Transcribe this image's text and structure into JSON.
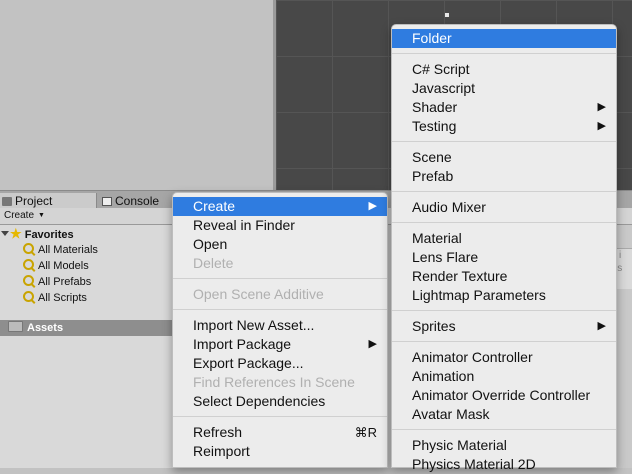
{
  "tabs": {
    "project": "Project",
    "console": "Console"
  },
  "toolbar": {
    "create": "Create"
  },
  "tree": {
    "favorites": "Favorites",
    "items": [
      "All Materials",
      "All Models",
      "All Prefabs",
      "All Scripts"
    ],
    "assets": "Assets"
  },
  "right_hint": "i\nis",
  "context_menu": {
    "create": "Create",
    "reveal": "Reveal in Finder",
    "open": "Open",
    "delete": "Delete",
    "open_scene_additive": "Open Scene Additive",
    "import_new_asset": "Import New Asset...",
    "import_package": "Import Package",
    "export_package": "Export Package...",
    "find_references": "Find References In Scene",
    "select_dependencies": "Select Dependencies",
    "refresh": "Refresh",
    "refresh_shortcut": "⌘R",
    "reimport": "Reimport"
  },
  "create_submenu": {
    "folder": "Folder",
    "csharp": "C# Script",
    "javascript": "Javascript",
    "shader": "Shader",
    "testing": "Testing",
    "scene": "Scene",
    "prefab": "Prefab",
    "audio_mixer": "Audio Mixer",
    "material": "Material",
    "lens_flare": "Lens Flare",
    "render_texture": "Render Texture",
    "lightmap_parameters": "Lightmap Parameters",
    "sprites": "Sprites",
    "animator_controller": "Animator Controller",
    "animation": "Animation",
    "animator_override_controller": "Animator Override Controller",
    "avatar_mask": "Avatar Mask",
    "physic_material": "Physic Material",
    "physics_material_2d": "Physics Material 2D"
  },
  "colors": {
    "highlight": "#2f7ce0",
    "menu_bg": "#ececec",
    "scene_bg": "#484848"
  }
}
